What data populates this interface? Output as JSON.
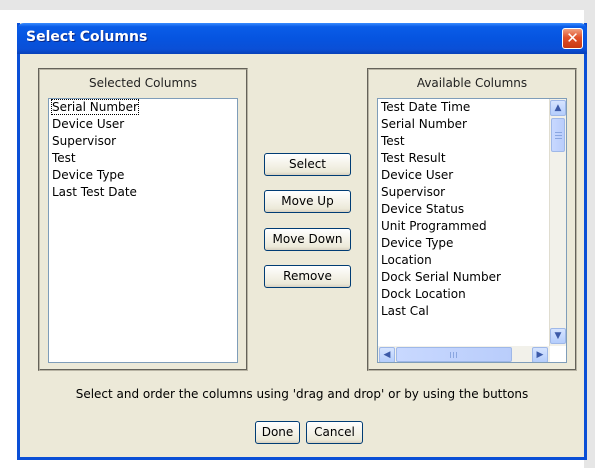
{
  "dialog": {
    "title": "Select Columns",
    "close_icon": "close-icon",
    "close_glyph": "✕"
  },
  "selected": {
    "title": "Selected Columns",
    "items": [
      "Serial Number",
      "Device User",
      "Supervisor",
      "Test",
      "Device Type",
      "Last Test Date"
    ],
    "focused_index": 0
  },
  "available": {
    "title": "Available Columns",
    "items": [
      "Test Date Time",
      "Serial Number",
      "Test",
      "Test Result",
      "Device User",
      "Supervisor",
      "Device Status",
      "Unit Programmed",
      "Device Type",
      "Location",
      "Dock Serial Number",
      "Dock Location",
      "Last Cal"
    ]
  },
  "buttons": {
    "select": "Select",
    "move_up": "Move Up",
    "move_down": "Move Down",
    "remove": "Remove",
    "done": "Done",
    "cancel": "Cancel"
  },
  "scroll_glyphs": {
    "up": "▲",
    "down": "▼",
    "left": "◀",
    "right": "▶"
  },
  "hint": "Select and order the columns using 'drag and drop' or by using the buttons",
  "colors": {
    "titlebar": "#0a5de8",
    "close": "#e0502a",
    "dialog_bg": "#ece9d8"
  }
}
